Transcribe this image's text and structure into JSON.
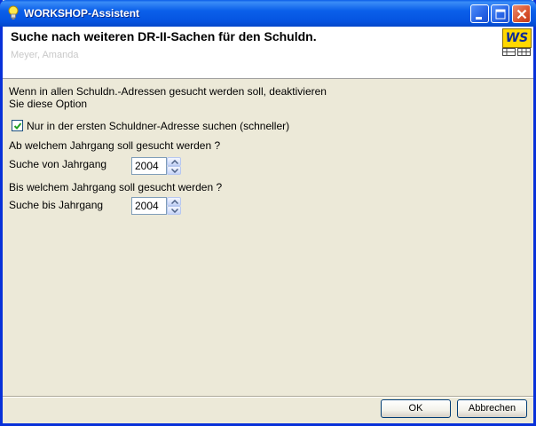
{
  "window": {
    "title": "WORKSHOP-Assistent"
  },
  "header": {
    "title": "Suche nach weiteren DR-II-Sachen für den Schuldn.",
    "subtitle": "Meyer, Amanda",
    "logo_text": "WS"
  },
  "main": {
    "intro_line1": "Wenn in allen Schuldn.-Adressen gesucht werden soll, deaktivieren",
    "intro_line2": "Sie diese Option",
    "checkbox_label": "Nur in der ersten Schuldner-Adresse suchen (schneller)",
    "checkbox_checked": true,
    "from_question": "Ab welchem Jahrgang soll gesucht werden ?",
    "from_label": "Suche von Jahrgang",
    "from_value": "2004",
    "to_question": "Bis welchem Jahrgang soll gesucht werden ?",
    "to_label": "Suche bis Jahrgang",
    "to_value": "2004"
  },
  "buttons": {
    "ok": "OK",
    "cancel": "Abbrechen"
  }
}
